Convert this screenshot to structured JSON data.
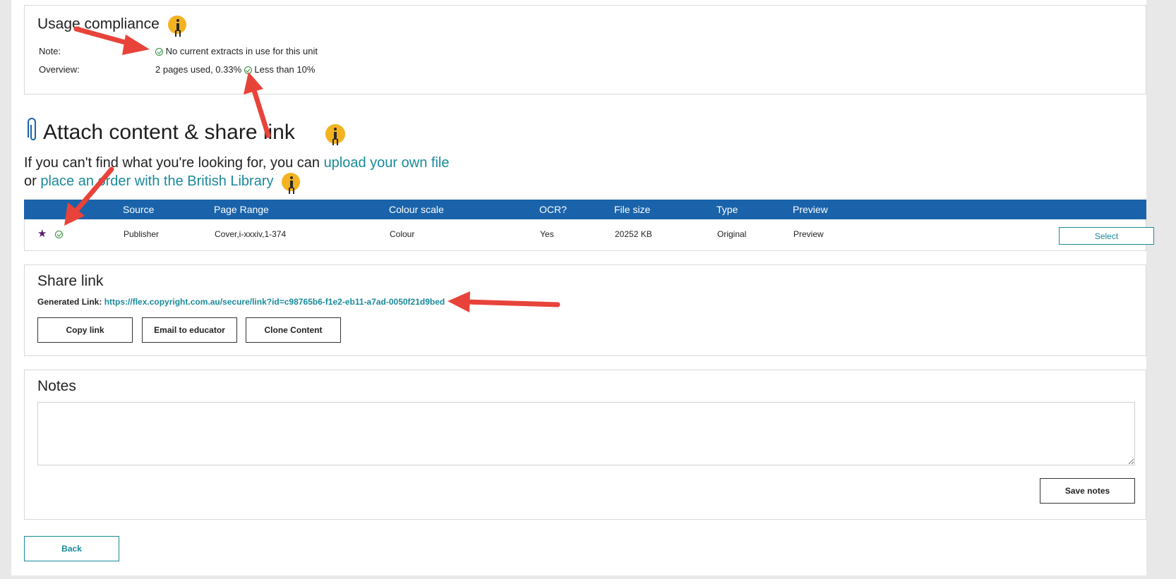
{
  "usage_compliance": {
    "title": "Usage compliance",
    "note_label": "Note:",
    "note_value": "No current extracts in use for this unit",
    "overview_label": "Overview:",
    "overview_value": "2 pages used, 0.33%",
    "overview_status": "Less than 10%"
  },
  "attach": {
    "title": "Attach content & share link",
    "line1_prefix": "If you can't find what you're looking for, you can ",
    "upload_link": "upload your own file",
    "line2_prefix": "or ",
    "order_link": "place an order with the British Library"
  },
  "table": {
    "headers": [
      "Source",
      "Page Range",
      "Colour scale",
      "OCR?",
      "File size",
      "Type",
      "Preview"
    ],
    "row": {
      "source": "Publisher",
      "page_range": "Cover,i-xxxiv,1-374",
      "colour_scale": "Colour",
      "ocr": "Yes",
      "file_size": "20252 KB",
      "type": "Original",
      "preview": "Preview",
      "select": "Select"
    }
  },
  "share": {
    "title": "Share link",
    "generated_label": "Generated Link:",
    "url": "https://flex.copyright.com.au/secure/link?id=c98765b6-f1e2-eb11-a7ad-0050f21d9bed",
    "copy_button": "Copy link",
    "email_button": "Email to educator",
    "clone_button": "Clone Content"
  },
  "notes": {
    "title": "Notes",
    "value": "",
    "save_button": "Save notes"
  },
  "back_button": "Back",
  "colors": {
    "accent_blue": "#1a63aa",
    "link_teal": "#1a8a9a",
    "info_yellow": "#f3b320",
    "check_green": "#2e8b3a",
    "annotation_red": "#e8433a",
    "star_purple": "#5a1a6e"
  }
}
